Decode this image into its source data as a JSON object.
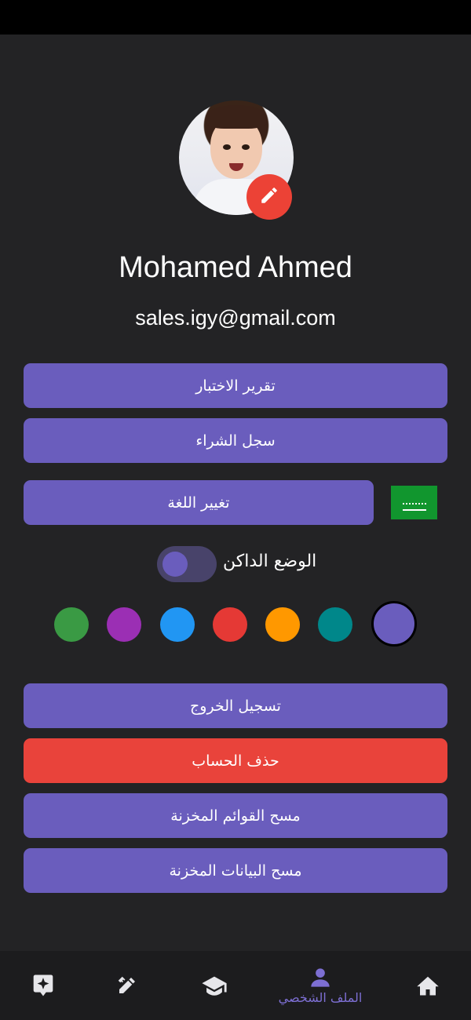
{
  "user": {
    "name": "Mohamed Ahmed",
    "email": "sales.igy@gmail.com"
  },
  "buttons": {
    "test_report": "تقرير الاختبار",
    "purchase_history": "سجل الشراء",
    "change_language": "تغيير اللغة",
    "logout": "تسجيل الخروج",
    "delete_account": "حذف الحساب",
    "clear_cached_lists": "مسح القوائم المخزنة",
    "clear_cached_data": "مسح البيانات المخزنة"
  },
  "dark_mode": {
    "label": "الوضع الداكن",
    "enabled": false
  },
  "theme_colors": {
    "options": [
      "#3a9a44",
      "#9b2fb4",
      "#2196f3",
      "#e53935",
      "#ff9800",
      "#00878a",
      "#6a5dbd"
    ],
    "selected": "#6a5dbd"
  },
  "colors": {
    "accent": "#6a5dbd",
    "danger": "#e9433b",
    "background": "#232325"
  },
  "bottom_nav": {
    "items": [
      {
        "icon": "sparkle-card-icon",
        "label": ""
      },
      {
        "icon": "pencil-ruler-icon",
        "label": ""
      },
      {
        "icon": "graduation-cap-icon",
        "label": ""
      },
      {
        "icon": "person-icon",
        "label": "الملف الشخصي",
        "active": true
      },
      {
        "icon": "home-icon",
        "label": ""
      }
    ]
  },
  "flag_icon": "saudi-flag-icon",
  "edit_icon": "pencil-icon"
}
